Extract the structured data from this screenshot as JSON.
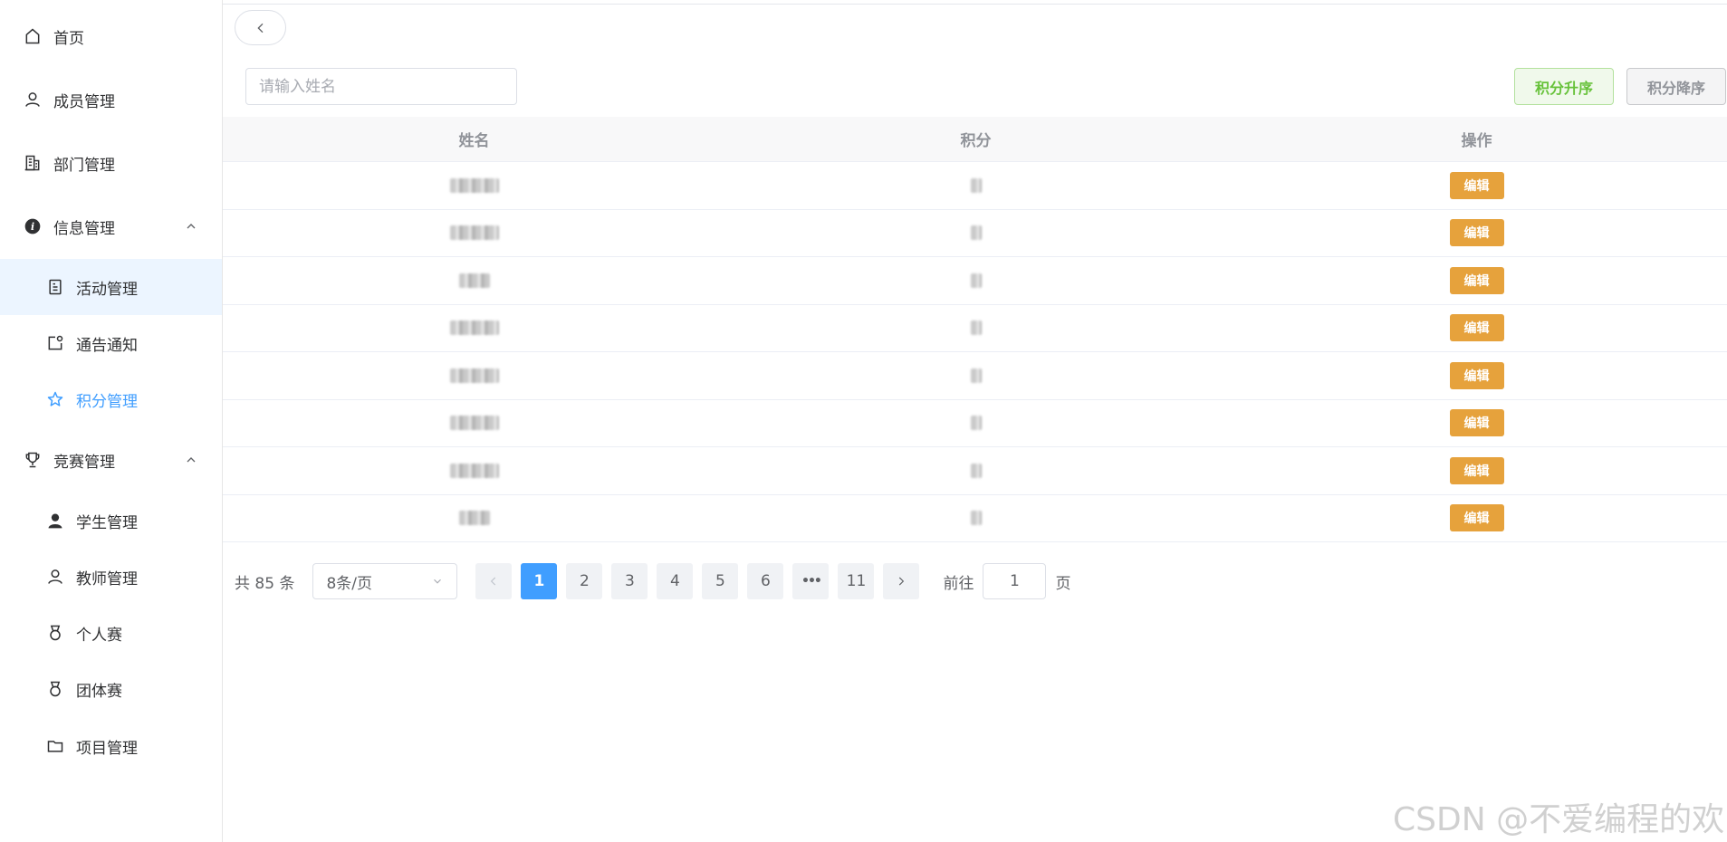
{
  "sidebar": {
    "items": [
      {
        "label": "首页",
        "icon": "home-icon"
      },
      {
        "label": "成员管理",
        "icon": "user-icon"
      },
      {
        "label": "部门管理",
        "icon": "office-building-icon"
      },
      {
        "label": "信息管理",
        "icon": "info-filled-icon",
        "expanded": true
      },
      {
        "label": "活动管理",
        "icon": "document-icon",
        "active": true
      },
      {
        "label": "通告通知",
        "icon": "notification-icon"
      },
      {
        "label": "积分管理",
        "icon": "star-icon",
        "selected": true
      },
      {
        "label": "竞赛管理",
        "icon": "trophy-icon",
        "expanded": true
      },
      {
        "label": "学生管理",
        "icon": "user-filled-icon"
      },
      {
        "label": "教师管理",
        "icon": "user-icon"
      },
      {
        "label": "个人赛",
        "icon": "medal-icon"
      },
      {
        "label": "团体赛",
        "icon": "medal-icon"
      },
      {
        "label": "项目管理",
        "icon": "folder-icon"
      }
    ]
  },
  "toolbar": {
    "search_placeholder": "请输入姓名",
    "asc_label": "积分升序",
    "desc_label": "积分降序"
  },
  "table": {
    "headers": [
      "姓名",
      "积分",
      "操作"
    ],
    "rows": [
      {
        "action": "编辑"
      },
      {
        "action": "编辑"
      },
      {
        "action": "编辑"
      },
      {
        "action": "编辑"
      },
      {
        "action": "编辑"
      },
      {
        "action": "编辑"
      },
      {
        "action": "编辑"
      },
      {
        "action": "编辑"
      }
    ]
  },
  "pagination": {
    "total_text": "共 85 条",
    "page_size": "8条/页",
    "pages": [
      "1",
      "2",
      "3",
      "4",
      "5",
      "6",
      "•••",
      "11"
    ],
    "current": "1",
    "goto_label": "前往",
    "goto_value": "1",
    "goto_suffix": "页"
  },
  "watermark": "CSDN @不爱编程的欢",
  "colors": {
    "primary": "#409eff",
    "success": "#67c23a",
    "warning": "#e6a23c",
    "active_bg": "#ecf5ff"
  }
}
